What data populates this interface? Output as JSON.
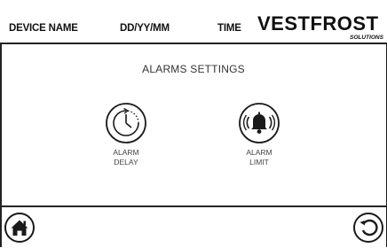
{
  "header": {
    "device_name": "DEVICE NAME",
    "date_format": "DD/YY/MM",
    "time": "TIME",
    "logo_text": "VESTFROST",
    "logo_sub": "SOLUTIONS"
  },
  "main": {
    "title": "ALARMS SETTINGS",
    "tiles": [
      {
        "line1": "ALARM",
        "line2": "DELAY",
        "icon": "clock-icon"
      },
      {
        "line1": "ALARM",
        "line2": "LIMIT",
        "icon": "bell-icon"
      }
    ]
  },
  "footer": {
    "home_icon": "home-icon",
    "back_icon": "back-icon"
  },
  "colors": {
    "ink": "#1a1a1a",
    "bg": "#ffffff"
  }
}
